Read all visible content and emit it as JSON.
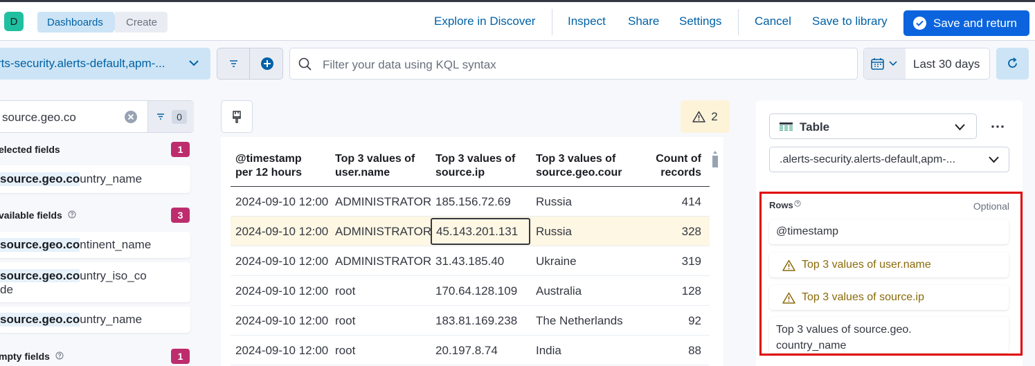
{
  "header": {
    "avatar_letter": "D",
    "breadcrumbs": [
      "Dashboards",
      "Create"
    ],
    "links": {
      "explore": "Explore in Discover",
      "inspect": "Inspect",
      "share": "Share",
      "settings": "Settings",
      "cancel": "Cancel",
      "save_library": "Save to library",
      "save_return": "Save and return"
    }
  },
  "query_bar": {
    "data_view": "rts-security.alerts-default,apm-...",
    "search_placeholder": "Filter your data using KQL syntax",
    "date_range": "Last 30 days"
  },
  "field_list": {
    "search_value": "source.geo.co",
    "filter_count": "0",
    "selected": {
      "label": "elected fields",
      "count": "1",
      "items": [
        {
          "match": "source.geo.co",
          "rest": "untry_name"
        }
      ]
    },
    "available": {
      "label": "vailable fields",
      "count": "3",
      "items": [
        {
          "match": "source.geo.co",
          "rest": "ntinent_name"
        },
        {
          "match": "source.geo.co",
          "rest": "untry_iso_co",
          "rest2": "de"
        },
        {
          "match": "source.geo.co",
          "rest": "untry_name"
        }
      ]
    },
    "empty": {
      "label": "mpty fields",
      "count": "1"
    }
  },
  "workspace": {
    "warning_count": "2",
    "table": {
      "columns": [
        [
          "@timestamp",
          "per 12 hours"
        ],
        [
          "Top 3 values of",
          "user.name"
        ],
        [
          "Top 3 values of",
          "source.ip"
        ],
        [
          "Top 3 values of",
          "source.geo.cour"
        ],
        [
          "Count of",
          "records"
        ]
      ],
      "rows": [
        [
          "2024-09-10 12:00",
          "ADMINISTRATOR",
          "185.156.72.69",
          "Russia",
          "414"
        ],
        [
          "2024-09-10 12:00",
          "ADMINISTRATOR",
          "45.143.201.131",
          "Russia",
          "328"
        ],
        [
          "2024-09-10 12:00",
          "ADMINISTRATOR",
          "31.43.185.40",
          "Ukraine",
          "319"
        ],
        [
          "2024-09-10 12:00",
          "root",
          "170.64.128.109",
          "Australia",
          "128"
        ],
        [
          "2024-09-10 12:00",
          "root",
          "183.81.169.238",
          "The Netherlands",
          "92"
        ],
        [
          "2024-09-10 12:00",
          "root",
          "20.197.8.74",
          "India",
          "88"
        ]
      ]
    }
  },
  "config_panel": {
    "chart_type": "Table",
    "data_view": ".alerts-security.alerts-default,apm-...",
    "rows_label": "Rows",
    "optional_label": "Optional",
    "row_items": [
      "@timestamp",
      "Top 3 values of user.name",
      "Top 3 values of source.ip",
      "Top 3 values of source.geo.",
      "country_name"
    ]
  },
  "colors": {
    "accent": "#0b64dd",
    "link": "#0061a6",
    "warning_text": "#8a6a0a",
    "badge": "#bd2d6d",
    "highlight_box": "#e00000"
  }
}
